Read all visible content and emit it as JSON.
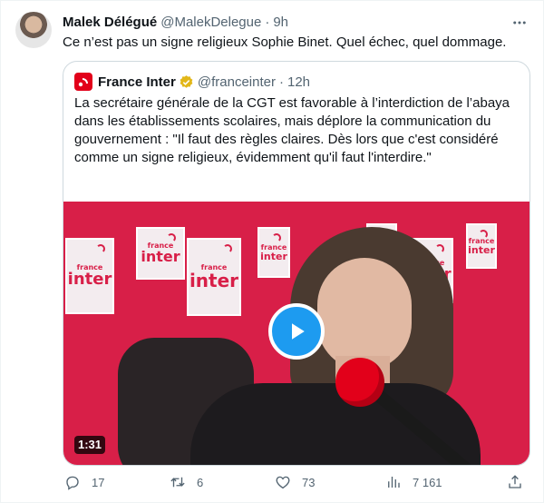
{
  "author": {
    "name": "Malek Délégué",
    "handle": "@MalekDelegue",
    "separator": "·",
    "time": "9h"
  },
  "tweet_text": "Ce n’est pas un signe religieux Sophie Binet. Quel échec, quel dommage.",
  "quoted": {
    "name": "France Inter",
    "handle": "@franceinter",
    "separator": "·",
    "time": "12h",
    "text": "La secrétaire générale de la CGT est favorable à l’interdiction de l’abaya dans les établissements scolaires, mais déplore la communication du gouvernement : \"Il faut des règles claires. Dès lors que c'est considéré comme un signe religieux, évidemment qu'il faut l'interdire.\"",
    "video_duration": "1:31",
    "panel_small": "france",
    "panel_big": "inter"
  },
  "actions": {
    "replies": "17",
    "retweets": "6",
    "likes": "73",
    "views": "7 161"
  },
  "icons": {
    "more": "more-horizontal-icon",
    "verified": "verified-badge-icon",
    "play": "play-icon",
    "reply": "reply-icon",
    "retweet": "retweet-icon",
    "like": "heart-icon",
    "views": "views-bar-chart-icon",
    "share": "share-icon"
  },
  "colors": {
    "accent": "#1d9bf0",
    "brand_red": "#e2001a",
    "studio_wall": "#d81f48",
    "verified_gold": "#e2b719",
    "muted_text": "#536471"
  }
}
